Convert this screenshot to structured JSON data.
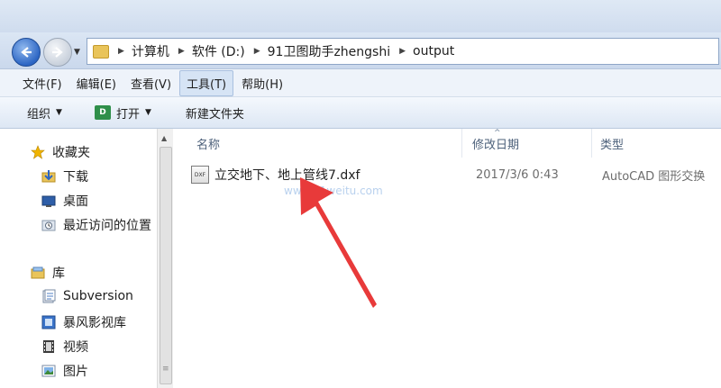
{
  "breadcrumb": [
    "计算机",
    "软件 (D:)",
    "91卫图助手zhengshi",
    "output"
  ],
  "menu": [
    "文件(F)",
    "编辑(E)",
    "查看(V)",
    "工具(T)",
    "帮助(H)"
  ],
  "toolbar": {
    "organize": "组织",
    "open": "打开",
    "new_folder": "新建文件夹"
  },
  "nav": {
    "favorites": "收藏夹",
    "downloads": "下载",
    "desktop": "桌面",
    "recent": "最近访问的位置",
    "libraries": "库",
    "subversion": "Subversion",
    "baofeng": "暴风影视库",
    "video": "视频",
    "pictures": "图片"
  },
  "columns": {
    "name": "名称",
    "modified": "修改日期",
    "type": "类型"
  },
  "files": [
    {
      "name": "立交地下、地上管线7.dxf",
      "modified": "2017/3/6 0:43",
      "type": "AutoCAD 图形交换",
      "icon_text": "DXF"
    }
  ],
  "watermark": "www.91weitu.com",
  "colors": {
    "accent": "#2d66c4",
    "arrow": "#e83a3a"
  }
}
